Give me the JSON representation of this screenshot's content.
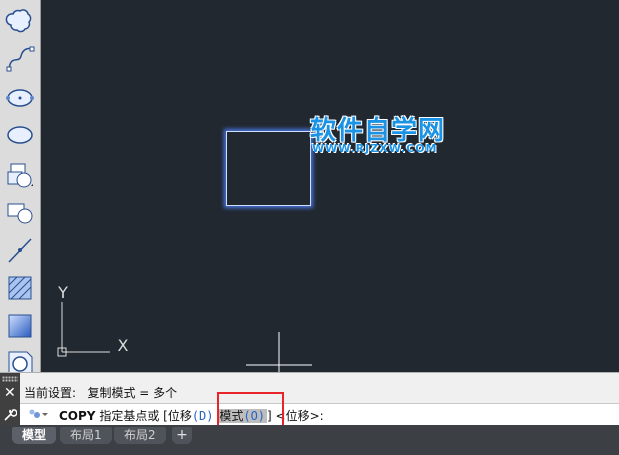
{
  "toolbar": {
    "tools": [
      {
        "name": "revision-cloud-icon"
      },
      {
        "name": "spline-icon"
      },
      {
        "name": "ellipse-icon"
      },
      {
        "name": "ellipse-arc-icon"
      },
      {
        "name": "insert-block-icon"
      },
      {
        "name": "make-block-icon"
      },
      {
        "name": "point-icon"
      },
      {
        "name": "hatch-icon"
      },
      {
        "name": "gradient-icon"
      },
      {
        "name": "region-icon"
      }
    ]
  },
  "canvas": {
    "background": "#212830",
    "object_color": "#cfe0ff",
    "watermark_title": "软件自学网",
    "watermark_url": "WWW.RJZXW.COM",
    "ucs_y_label": "Y",
    "ucs_x_label": "X"
  },
  "command": {
    "history_line": "当前设置:   复制模式 = 多个",
    "command_name": "COPY",
    "prompt": " 指定基点或 [",
    "option_move_label": "位移",
    "option_move_hotkey": "(D)",
    "option_mode_label": "模式",
    "option_mode_hotkey": "(O)",
    "prompt_end": "] <位移>:"
  },
  "tabs": {
    "items": [
      "模型",
      "布局1",
      "布局2"
    ],
    "add_label": "+"
  },
  "colors": {
    "highlight_box": "#e8242a",
    "hotkey": "#2463c9"
  }
}
